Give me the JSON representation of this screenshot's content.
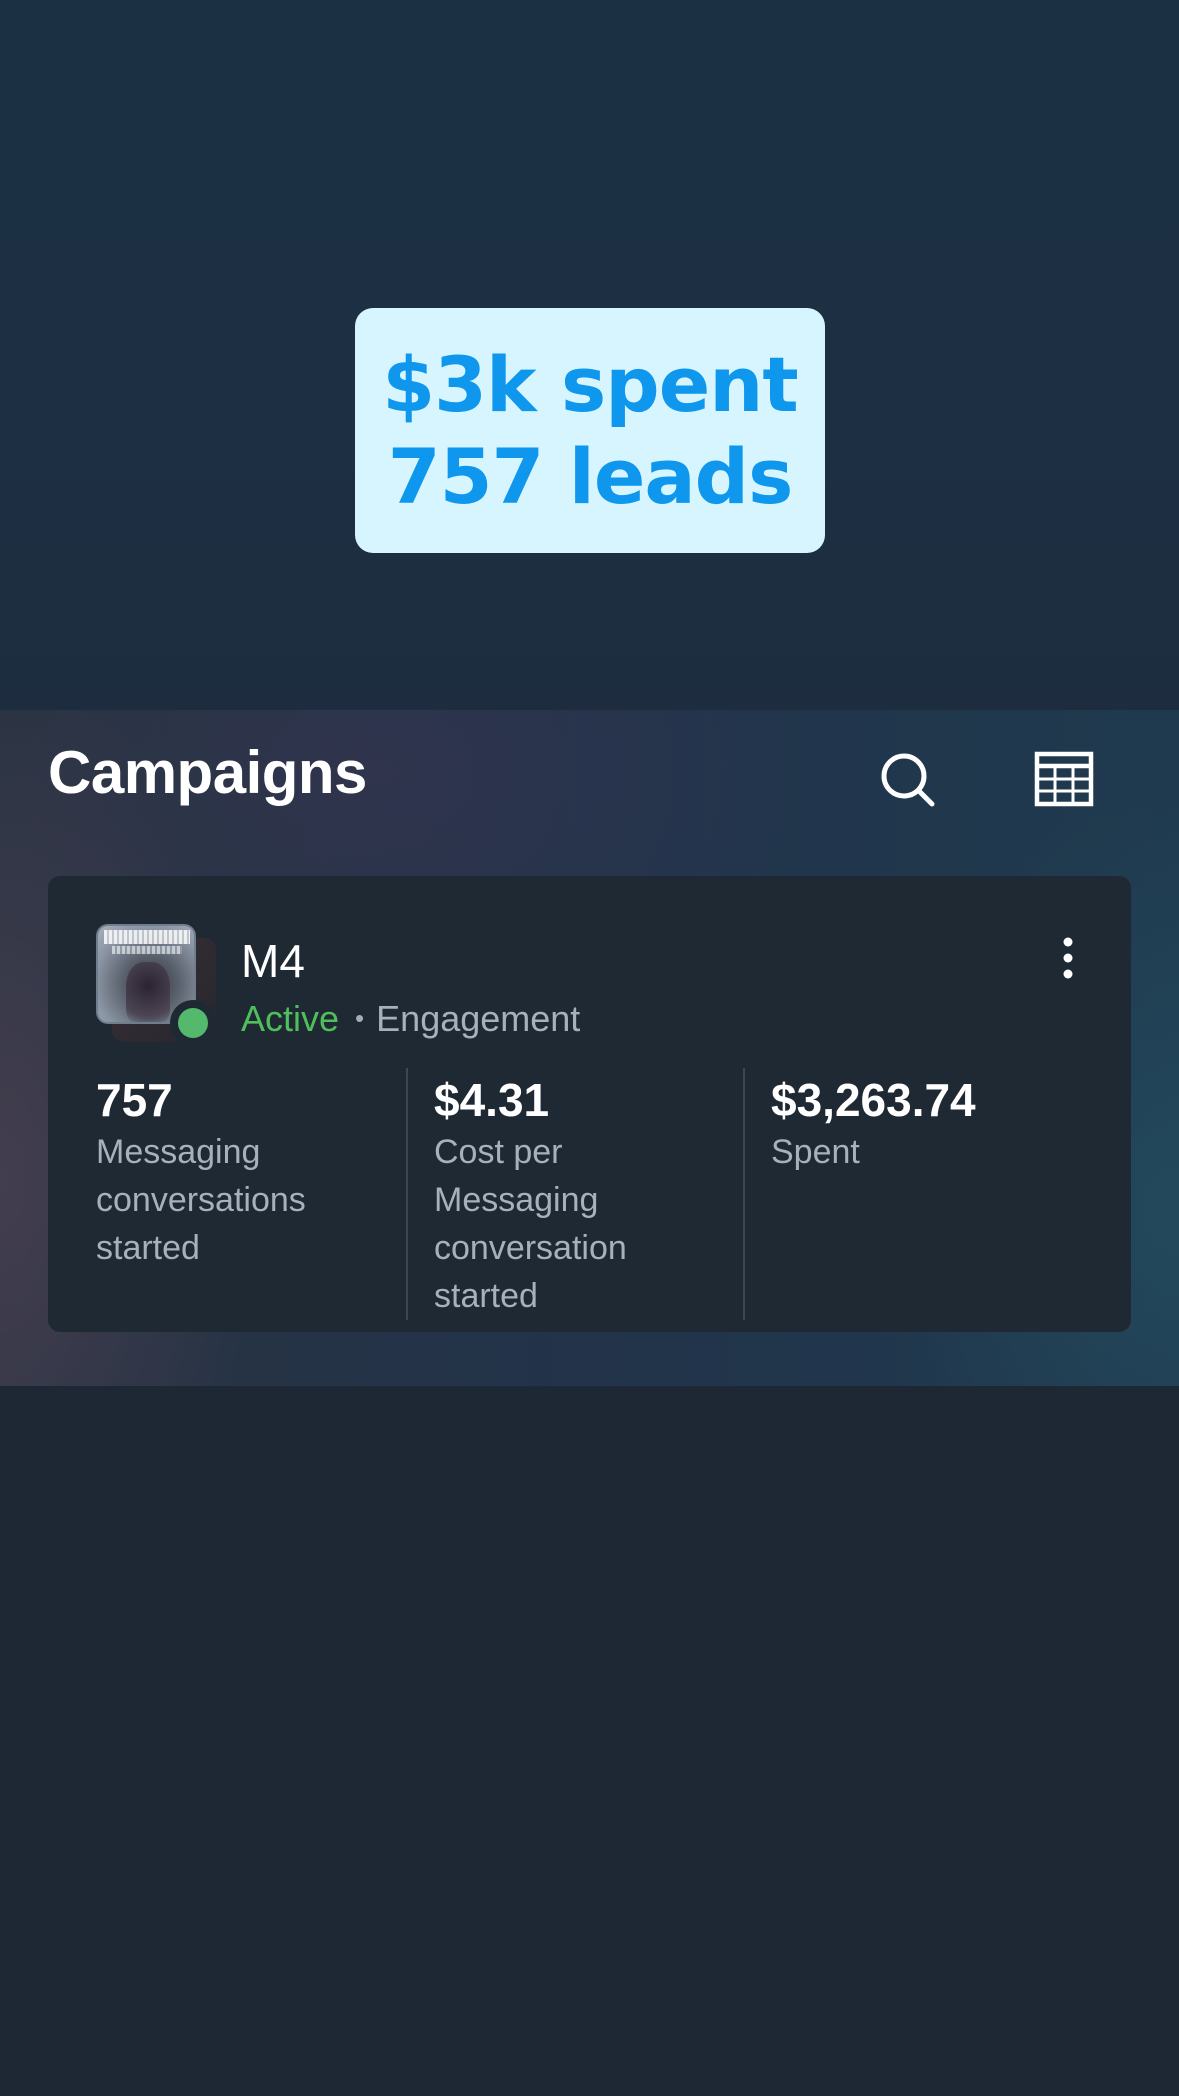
{
  "promo": {
    "line1": "$3k spent",
    "line2": "757 leads"
  },
  "header": {
    "title": "Campaigns",
    "search_icon": "search-icon",
    "table_icon": "table-grid-icon"
  },
  "campaign": {
    "name": "M4",
    "status": "Active",
    "objective": "Engagement",
    "status_color": "#4fbf5b",
    "menu_icon": "more-vertical-icon",
    "metrics": [
      {
        "value": "757",
        "label": "Messaging conversations started"
      },
      {
        "value": "$4.31",
        "label": "Cost per Messaging conversation started"
      },
      {
        "value": "$3,263.74",
        "label": "Spent"
      }
    ]
  },
  "colors": {
    "promo_bg": "#d6f5ff",
    "promo_text": "#0f97ee",
    "card_bg": "#1f2933",
    "status_dot": "#55b96d"
  }
}
